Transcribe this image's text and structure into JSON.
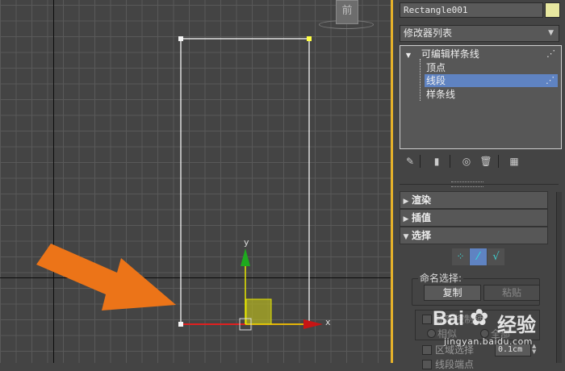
{
  "viewport": {
    "view_cube_label": "前",
    "axis_y_label": "y",
    "axis_x_label": "x"
  },
  "panel": {
    "object_name": "Rectangle001",
    "object_color": "#e8e8a0",
    "modifier_list_label": "修改器列表",
    "stack": {
      "root": "可编辑样条线",
      "children": [
        "顶点",
        "线段",
        "样条线"
      ],
      "selected": "线段"
    },
    "rollouts": [
      {
        "label": "渲染",
        "expanded": false
      },
      {
        "label": "插值",
        "expanded": false
      },
      {
        "label": "选择",
        "expanded": true
      }
    ],
    "named_selection": {
      "title": "命名选择:",
      "copy_label": "复制",
      "paste_label": "粘贴"
    },
    "lower_options": {
      "lock_handles": "锁定控制柄",
      "similar": "相似",
      "all": "全部",
      "area_select": "区域选择",
      "area_value": "0.1cm",
      "segment_end": "线段端点"
    }
  },
  "watermark": {
    "brand": "Bai",
    "brand2": "经验",
    "url": "jingyan.baidu.com"
  },
  "colors": {
    "accent_selection": "#5f83c2",
    "annotation_arrow": "#ec7418",
    "gizmo_x": "#c81414",
    "gizmo_y": "#1eaa1e",
    "gizmo_plane": "#e6e600"
  }
}
